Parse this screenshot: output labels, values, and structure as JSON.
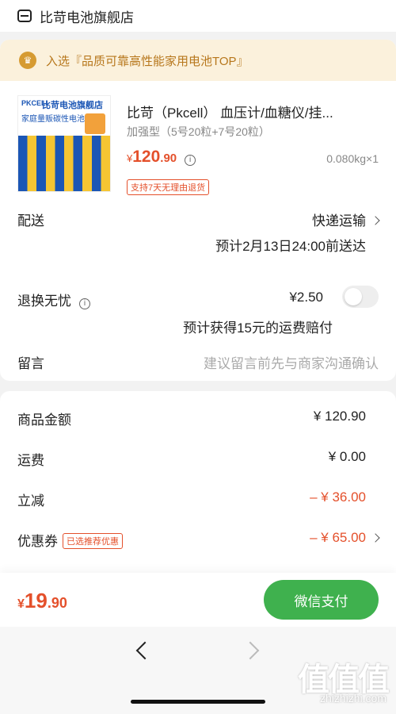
{
  "store": {
    "name": "比苛电池旗舰店"
  },
  "banner": {
    "text": "入选『品质可靠高性能家用电池TOP』"
  },
  "product": {
    "thumb_brand": "PKCELL",
    "thumb_title": "比苛电池旗舰店",
    "thumb_subtitle": "家庭量贩碳性电池",
    "title": "比苛（Pkcell） 血压计/血糖仪/挂...",
    "spec": "加强型（5号20粒+7号20粒）",
    "price_symbol": "¥",
    "price_int": "120",
    "price_dec": ".90",
    "weight_qty": "0.080kg×1",
    "return_tag": "支持7天无理由退货"
  },
  "delivery": {
    "label": "配送",
    "method": "快递运输",
    "eta": "预计2月13日24:00前送达"
  },
  "return_insurance": {
    "label": "退换无忧",
    "price": "¥2.50",
    "desc": "预计获得15元的运费赔付",
    "enabled": false
  },
  "message": {
    "label": "留言",
    "placeholder": "建议留言前先与商家沟通确认"
  },
  "summary": {
    "goods_label": "商品金额",
    "goods_value": "¥ 120.90",
    "shipping_label": "运费",
    "shipping_value": "¥ 0.00",
    "discount_label": "立减",
    "discount_value": "– ¥ 36.00",
    "coupon_label": "优惠券",
    "coupon_tag": "已选推荐优惠",
    "coupon_value": "– ¥ 65.00"
  },
  "checkout": {
    "total_symbol": "¥",
    "total_int": "19",
    "total_dec": ".90",
    "pay_label": "微信支付"
  },
  "watermark": {
    "logo": "值值值",
    "url": "zhizhizhi.com"
  },
  "colors": {
    "accent": "#e4502b",
    "pay_green": "#3fb14e",
    "banner_bg": "#fbf1dc",
    "banner_text": "#b7771c"
  }
}
